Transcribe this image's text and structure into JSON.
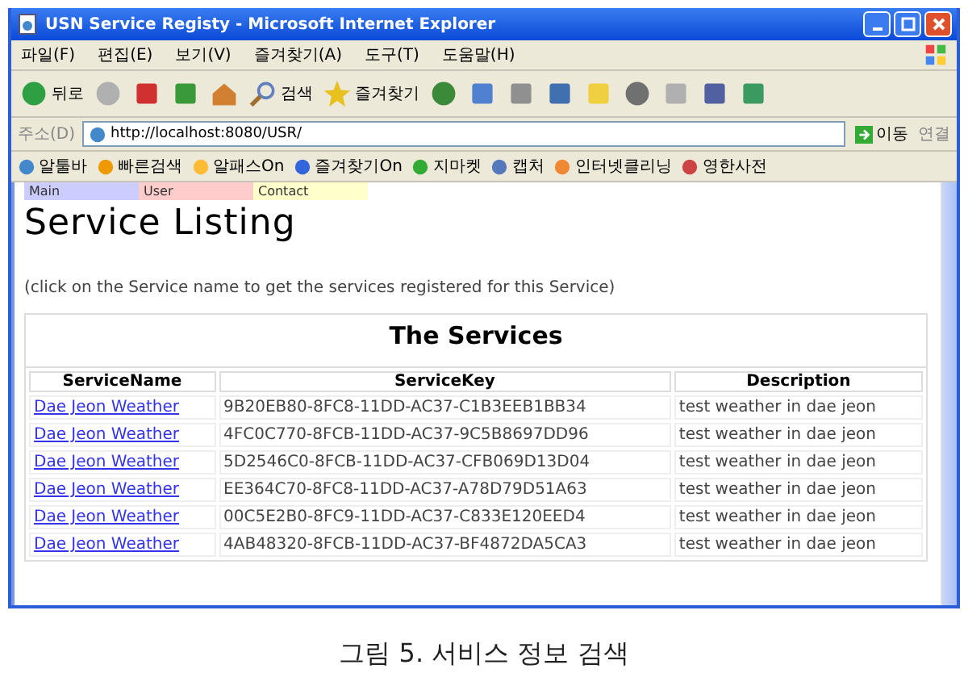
{
  "window": {
    "title": "USN Service Registy - Microsoft Internet Explorer"
  },
  "menu": [
    "파일(F)",
    "편집(E)",
    "보기(V)",
    "즐겨찾기(A)",
    "도구(T)",
    "도움말(H)"
  ],
  "toolbar": [
    {
      "kind": "back",
      "label": "뒤로"
    },
    {
      "kind": "forward"
    },
    {
      "kind": "stop"
    },
    {
      "kind": "refresh"
    },
    {
      "kind": "home"
    },
    {
      "kind": "search",
      "label": "검색"
    },
    {
      "kind": "favorites",
      "label": "즐겨찾기"
    },
    {
      "kind": "history"
    },
    {
      "kind": "mail"
    },
    {
      "kind": "print"
    },
    {
      "kind": "edit"
    },
    {
      "kind": "note"
    },
    {
      "kind": "block"
    },
    {
      "kind": "key"
    },
    {
      "kind": "research"
    },
    {
      "kind": "messenger"
    }
  ],
  "address": {
    "label": "주소(D)",
    "value": "http://localhost:8080/USR/",
    "go": "이동",
    "links": "연결"
  },
  "links_bar": [
    "알툴바",
    "빠른검색",
    "알패스On",
    "즐겨찾기On",
    "지마켓",
    "캡처",
    "인터넷클리닝",
    "영한사전"
  ],
  "page_tabs": [
    {
      "label": "Main",
      "color": "#ccccff"
    },
    {
      "label": "User",
      "color": "#ffcccc"
    },
    {
      "label": "Contact",
      "color": "#ffffcc"
    }
  ],
  "heading": "Service Listing",
  "note": "(click on the Service name to get the services registered for this Service)",
  "table": {
    "caption": "The Services",
    "columns": [
      "ServiceName",
      "ServiceKey",
      "Description"
    ],
    "rows": [
      [
        "Dae Jeon Weather",
        "9B20EB80-8FC8-11DD-AC37-C1B3EEB1BB34",
        "test weather in dae jeon"
      ],
      [
        "Dae Jeon Weather",
        "4FC0C770-8FCB-11DD-AC37-9C5B8697DD96",
        "test weather in dae jeon"
      ],
      [
        "Dae Jeon Weather",
        "5D2546C0-8FCB-11DD-AC37-CFB069D13D04",
        "test weather in dae jeon"
      ],
      [
        "Dae Jeon Weather",
        "EE364C70-8FC8-11DD-AC37-A78D79D51A63",
        "test weather in dae jeon"
      ],
      [
        "Dae Jeon Weather",
        "00C5E2B0-8FC9-11DD-AC37-C833E120EED4",
        "test weather in dae jeon"
      ],
      [
        "Dae Jeon Weather",
        "4AB48320-8FCB-11DD-AC37-BF4872DA5CA3",
        "test weather in dae jeon"
      ]
    ]
  },
  "figure_caption": "그림 5. 서비스 정보 검색"
}
